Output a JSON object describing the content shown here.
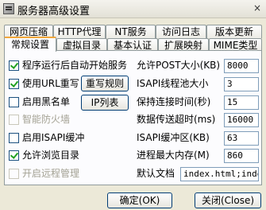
{
  "window": {
    "title": "服务器高级设置",
    "close_glyph": "×"
  },
  "tabs_row1": [
    {
      "label": "网页压缩"
    },
    {
      "label": "HTTP代理"
    },
    {
      "label": "NT服务"
    },
    {
      "label": "访问日志"
    },
    {
      "label": "版本更新"
    }
  ],
  "tabs_row2": [
    {
      "label": "常规设置",
      "active": true
    },
    {
      "label": "虚拟目录"
    },
    {
      "label": "基本认证"
    },
    {
      "label": "扩展映射"
    },
    {
      "label": "MIME类型"
    }
  ],
  "options": [
    {
      "label": "程序运行后自动开始服务",
      "checked": true,
      "enabled": true
    },
    {
      "label": "使用URL重写",
      "checked": true,
      "enabled": true
    },
    {
      "label": "启用黑名单",
      "checked": false,
      "enabled": true
    },
    {
      "label": "智能防火墙",
      "checked": false,
      "enabled": false
    },
    {
      "label": "启用ISAPI缓冲",
      "checked": false,
      "enabled": true
    },
    {
      "label": "允许浏览目录",
      "checked": true,
      "enabled": true
    },
    {
      "label": "开启远程管理",
      "checked": false,
      "enabled": false
    }
  ],
  "buttons": {
    "rewrite_rules": "重写规则",
    "ip_list": "IP列表",
    "ok": "确定(OK)",
    "close": "关闭(Close)"
  },
  "settings": [
    {
      "label": "允许POST大小(KB)",
      "value": "8000"
    },
    {
      "label": "ISAPI线程池大小",
      "value": "3"
    },
    {
      "label": "保持连接时间(秒)",
      "value": "15"
    },
    {
      "label": "数据传送超时(ms)",
      "value": "16000"
    },
    {
      "label": "ISAPI缓冲区(KB)",
      "value": "63"
    },
    {
      "label": "进程最大内存(M)",
      "value": "860"
    },
    {
      "label": "默认文档",
      "value": "index.html;index."
    }
  ]
}
